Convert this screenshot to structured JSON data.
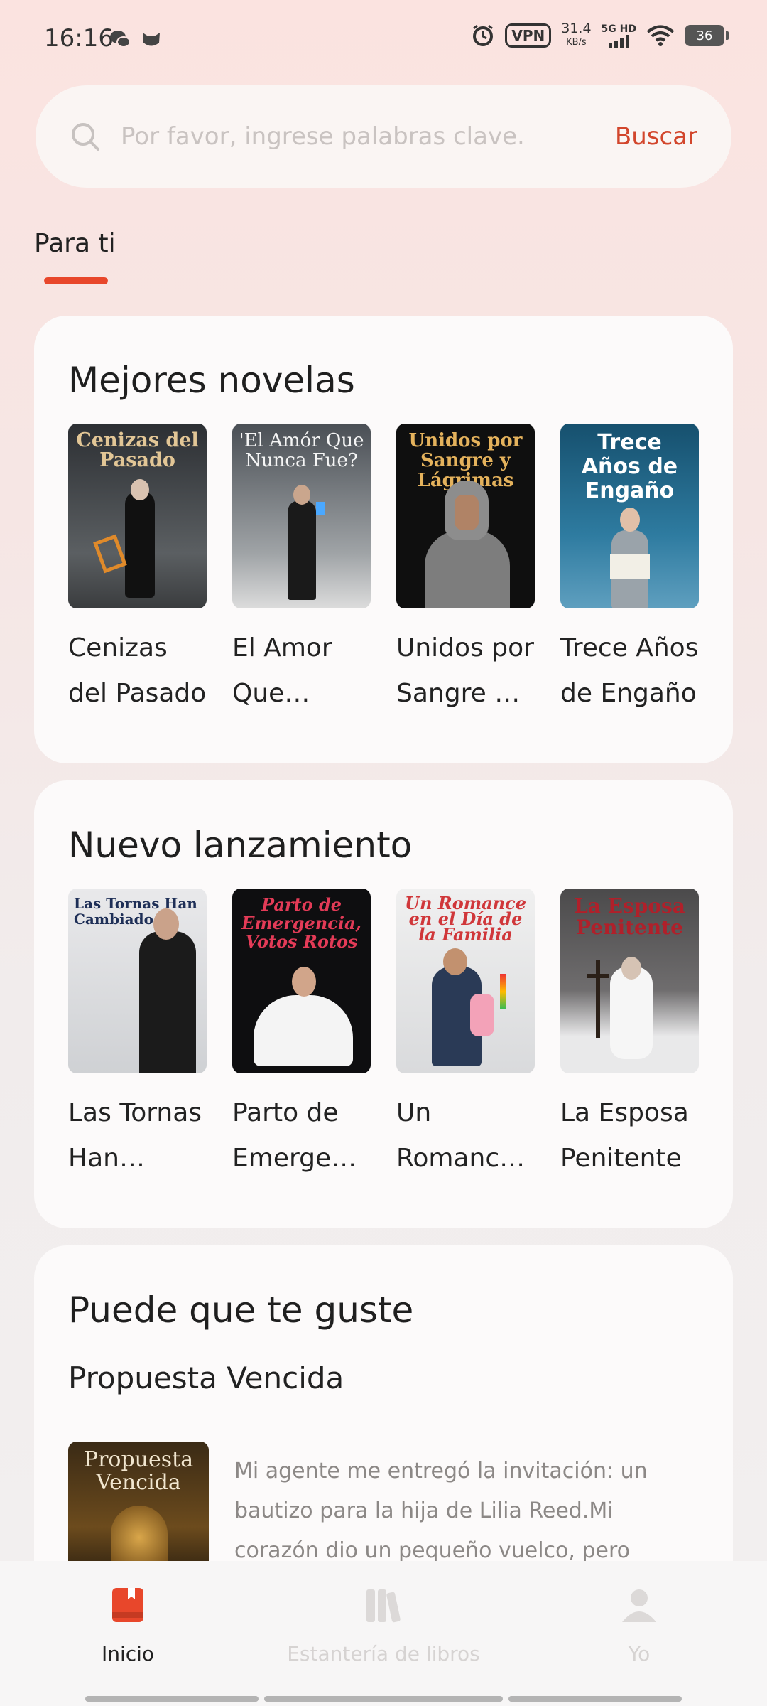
{
  "status_bar": {
    "time": "16:16",
    "vpn": "VPN",
    "speed": "31.4",
    "speed_unit": "KB/s",
    "network": "5G HD",
    "battery": "36"
  },
  "search": {
    "placeholder": "Por favor, ingrese palabras clave.",
    "button": "Buscar"
  },
  "tabs": [
    {
      "label": "Para ti",
      "active": true
    }
  ],
  "sections": {
    "top": {
      "title": "Mejores novelas",
      "books": [
        {
          "title": "Cenizas del Pasado",
          "cover_text": "Cenizas del Pasado"
        },
        {
          "title": "El Amor Que Nunca Fue",
          "cover_text": "'El Amór Que Nunca Fue?"
        },
        {
          "title": "Unidos por Sangre y Lágrimas",
          "cover_text": "Unidos por Sangre y Lágrimas"
        },
        {
          "title": "Trece Años de Engaño",
          "cover_text": "Trece Años de Engaño"
        }
      ]
    },
    "new": {
      "title": "Nuevo lanzamiento",
      "books": [
        {
          "title": "Las Tornas Han Cambiado",
          "cover_text": "Las Tornas Han Cambiado"
        },
        {
          "title": "Parto de Emergencia, Votos Rotos",
          "cover_text": "Parto de Emergencia, Votos Rotos"
        },
        {
          "title": "Un Romance en el Día de la Familia",
          "cover_text": "Un Romance en el Día de la Familia"
        },
        {
          "title": "La Esposa Penitente",
          "cover_text": "La Esposa Penitente"
        }
      ]
    },
    "like": {
      "title": "Puede que te guste",
      "book_title": "Propuesta Vencida",
      "cover_text": "Propuesta Vencida",
      "description": "Mi agente me entregó la invitación: un bautizo para la hija de Lilia Reed.Mi corazón dio un pequeño vuelco, pero mantuve mi voz firme."
    }
  },
  "nav": [
    {
      "label": "Inicio",
      "icon": "book-icon",
      "active": true
    },
    {
      "label": "Estantería de libros",
      "icon": "bookshelf-icon",
      "active": false
    },
    {
      "label": "Yo",
      "icon": "user-icon",
      "active": false
    }
  ],
  "colors": {
    "accent": "#e8472b",
    "search_button": "#d2462c"
  }
}
